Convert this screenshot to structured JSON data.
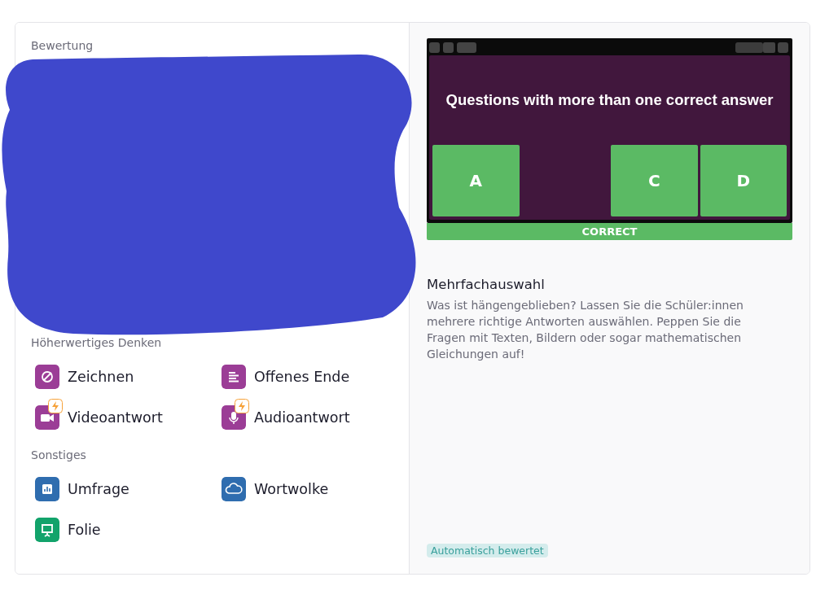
{
  "sections": [
    {
      "heading": "Bewertung"
    },
    {
      "heading": "Höherwertiges Denken",
      "items": [
        {
          "label": "Zeichnen",
          "kind": "draw",
          "color": "#9b3d96",
          "premium": false
        },
        {
          "label": "Offenes Ende",
          "kind": "text",
          "color": "#9b3d96",
          "premium": false
        },
        {
          "label": "Videoantwort",
          "kind": "video",
          "color": "#9b3d96",
          "premium": true
        },
        {
          "label": "Audioantwort",
          "kind": "audio",
          "color": "#9b3d96",
          "premium": true
        }
      ]
    },
    {
      "heading": "Sonstiges",
      "items": [
        {
          "label": "Umfrage",
          "kind": "poll",
          "color": "#2f6daf",
          "premium": false
        },
        {
          "label": "Wortwolke",
          "kind": "cloud",
          "color": "#2f6daf",
          "premium": false
        },
        {
          "label": "Folie",
          "kind": "slide",
          "color": "#12a36b",
          "premium": false
        }
      ]
    }
  ],
  "preview": {
    "question": "Questions with more than one correct answer",
    "options": [
      {
        "kind": "tile",
        "label": "A"
      },
      {
        "kind": "empty"
      },
      {
        "kind": "tile",
        "label": "C"
      },
      {
        "kind": "tile",
        "label": "D"
      }
    ],
    "result": "CORRECT"
  },
  "detail": {
    "title": "Mehrfachauswahl",
    "description": "Was ist hängengeblieben? Lassen Sie die Schüler:innen mehrere richtige Antworten auswählen. Peppen Sie die Fragen mit Texten, Bildern oder sogar mathematischen Gleichungen auf!",
    "badge": "Automatisch bewertet"
  }
}
